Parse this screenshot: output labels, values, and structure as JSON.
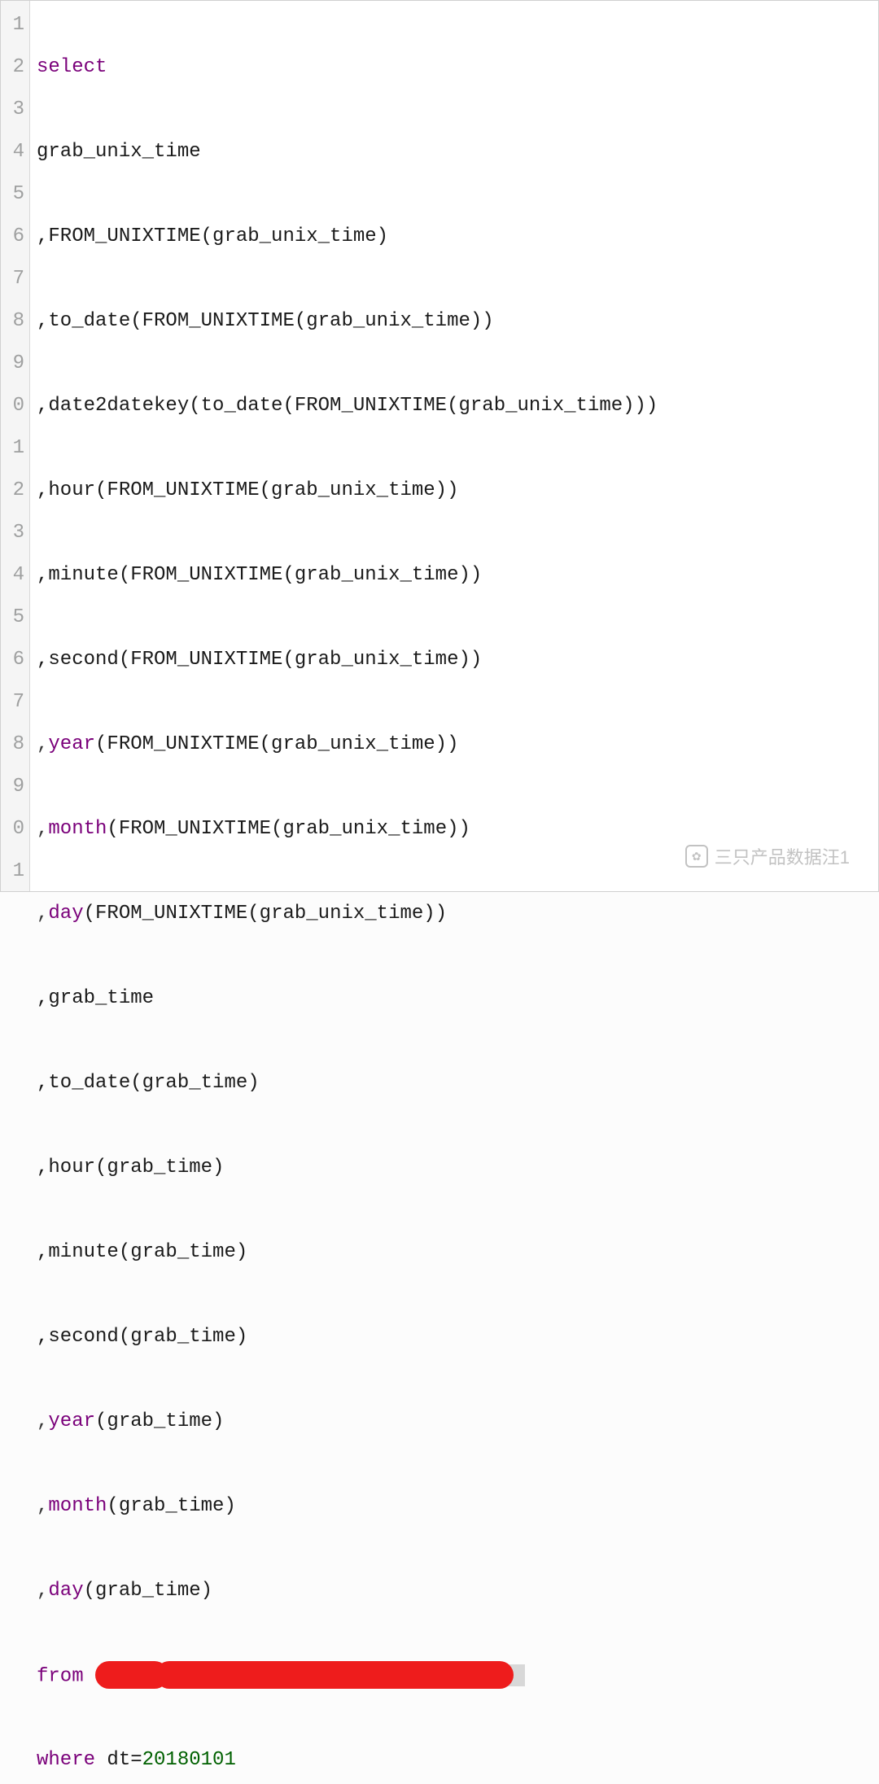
{
  "gutter": {
    "lines": [
      "1",
      "2",
      "3",
      "4",
      "5",
      "6",
      "7",
      "8",
      "9",
      "0",
      "1",
      "2",
      "3",
      "4",
      "5",
      "6",
      "7",
      "8",
      "9",
      "0",
      "1"
    ]
  },
  "code": {
    "l1_kw": "select",
    "l2": "grab_unix_time",
    "l3_pre": ",FROM_UNIXTIME(grab_unix_time)",
    "l4_pre": ",to_date(FROM_UNIXTIME(grab_unix_time))",
    "l5_pre": ",date2datekey(to_date(FROM_UNIXTIME(grab_unix_time)))",
    "l6_pre": ",hour(FROM_UNIXTIME(grab_unix_time))",
    "l7_pre": ",minute(FROM_UNIXTIME(grab_unix_time))",
    "l8_pre": ",second(FROM_UNIXTIME(grab_unix_time))",
    "l9_comma": ",",
    "l9_kw": "year",
    "l9_rest": "(FROM_UNIXTIME(grab_unix_time))",
    "l10_comma": ",",
    "l10_kw": "month",
    "l10_rest": "(FROM_UNIXTIME(grab_unix_time))",
    "l11_comma": ",",
    "l11_kw": "day",
    "l11_rest": "(FROM_UNIXTIME(grab_unix_time))",
    "l12": ",grab_time",
    "l13": ",to_date(grab_time)",
    "l14": ",hour(grab_time)",
    "l15": ",minute(grab_time)",
    "l16": ",second(grab_time)",
    "l17_comma": ",",
    "l17_kw": "year",
    "l17_rest": "(grab_time)",
    "l18_comma": ",",
    "l18_kw": "month",
    "l18_rest": "(grab_time)",
    "l19_comma": ",",
    "l19_kw": "day",
    "l19_rest": "(grab_time)",
    "l20_kw": "from",
    "l20_space": " ",
    "l21_kw": "where",
    "l21_mid": " dt=",
    "l21_num": "20180101"
  },
  "watermark": {
    "text": "三只产品数据汪1",
    "icon_glyph": "✿"
  }
}
